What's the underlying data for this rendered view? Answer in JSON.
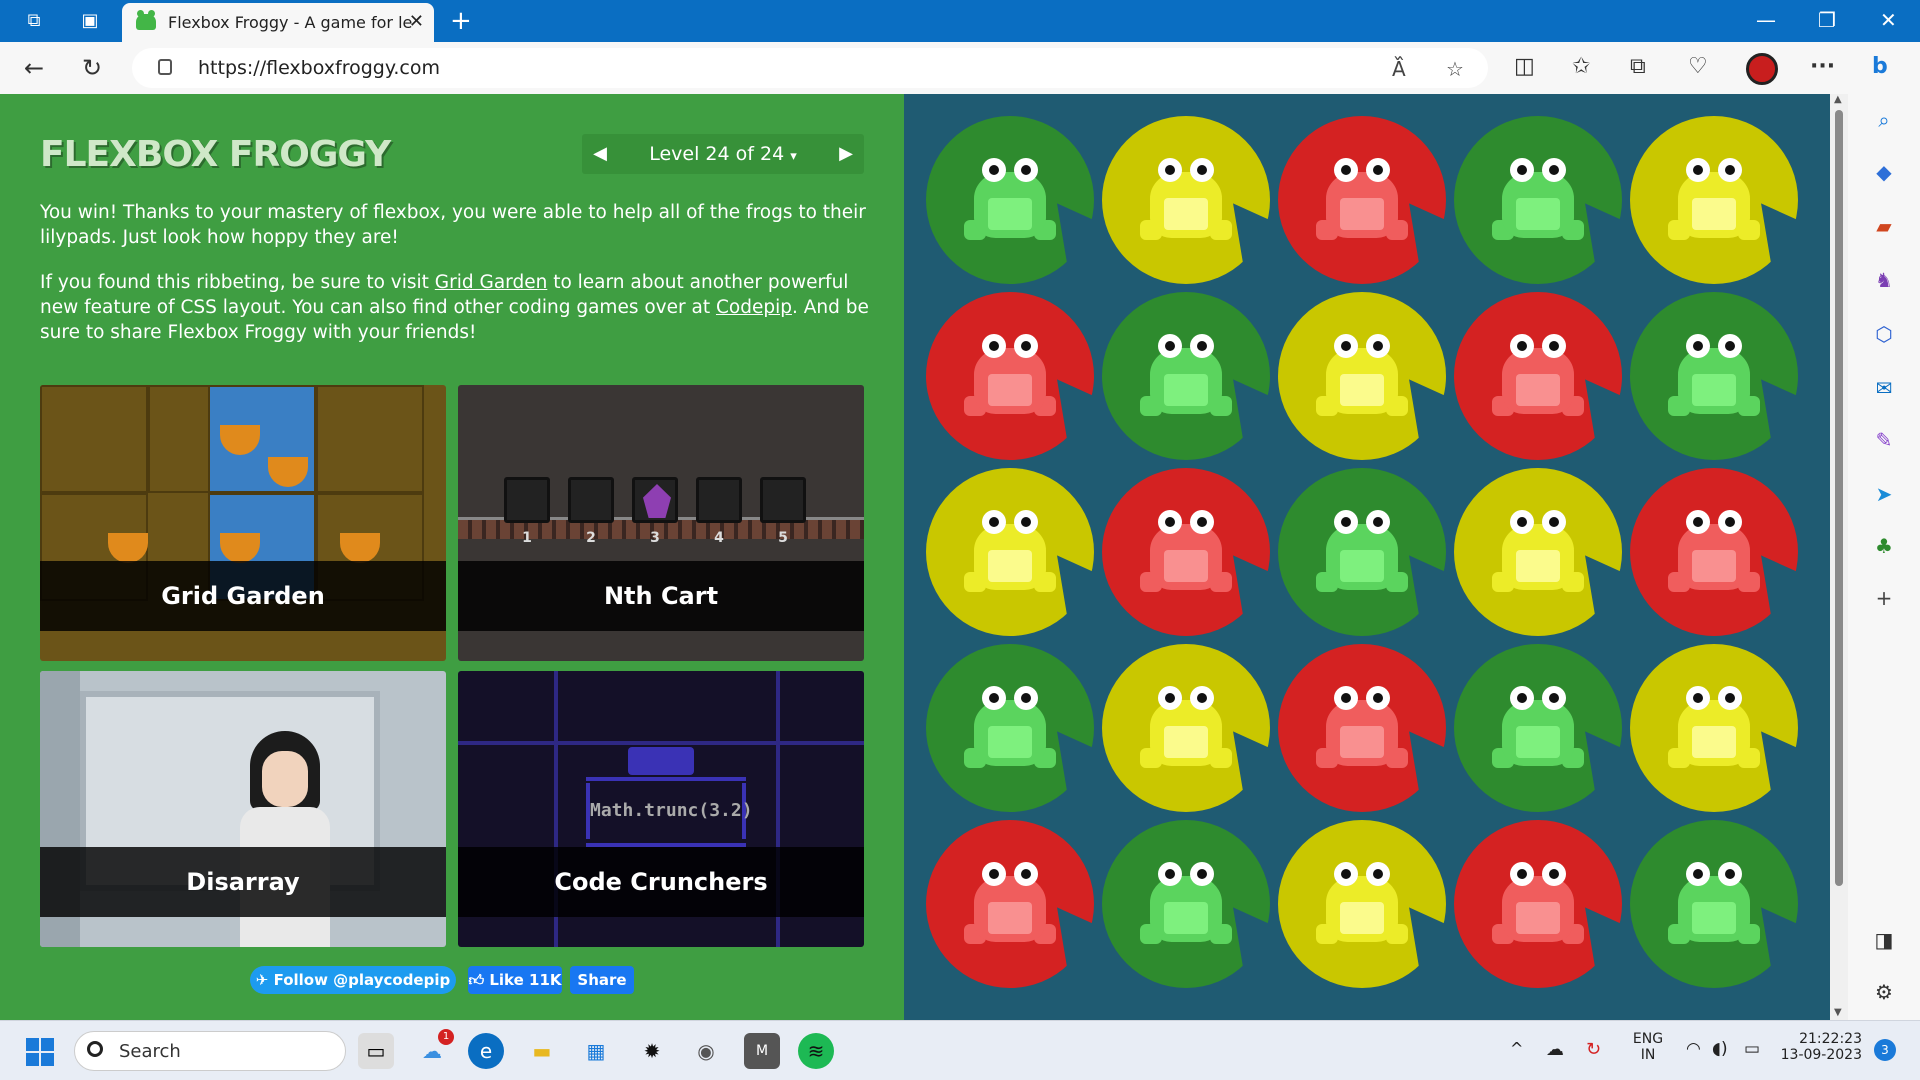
{
  "browser": {
    "tab_title": "Flexbox Froggy - A game for lear",
    "tab_close": "✕",
    "new_tab": "+",
    "url": "https://flexboxfroggy.com",
    "window_controls": {
      "minimize": "—",
      "restore": "❐",
      "close": "✕"
    },
    "menu_label": "···"
  },
  "game": {
    "logo": "FLEXBOX FROGGY",
    "level_label": "Level 24 of 24",
    "level_caret": "▾",
    "prev_arrow": "◀",
    "next_arrow": "▶",
    "win_text": "You win! Thanks to your mastery of flexbox, you were able to help all of the frogs to their lilypads. Just look how hoppy they are!",
    "visit": {
      "p1": "If you found this ribbeting, be sure to visit ",
      "link1": "Grid Garden",
      "p2": " to learn about another powerful new feature of CSS layout. You can also find other coding games over at ",
      "link2": "Codepip",
      "p3": ". And be sure to share Flexbox Froggy with your friends!"
    },
    "cards": [
      {
        "title": "Grid Garden"
      },
      {
        "title": "Nth Cart"
      },
      {
        "title": "Disarray"
      },
      {
        "title": "Code Crunchers"
      }
    ],
    "nth_cart_numbers": [
      "1",
      "2",
      "3",
      "4",
      "5"
    ],
    "code_crunchers_code": "Math.trunc(3.2)",
    "social": {
      "follow": "Follow @playcodepip",
      "like": "Like 11K",
      "share": "Share"
    }
  },
  "pond": {
    "colors": {
      "green": {
        "pad": "#2e8b2e",
        "frog": "#5bd45e",
        "belly": "#7ef07e"
      },
      "yellow": {
        "pad": "#c9c700",
        "frog": "#ecec28",
        "belly": "#fbfb8c"
      },
      "red": {
        "pad": "#d42222",
        "frog": "#f05d5d",
        "belly": "#f99090"
      }
    },
    "grid": [
      [
        "green",
        "yellow",
        "red",
        "green",
        "yellow"
      ],
      [
        "red",
        "green",
        "yellow",
        "red",
        "green"
      ],
      [
        "yellow",
        "red",
        "green",
        "yellow",
        "red"
      ],
      [
        "green",
        "yellow",
        "red",
        "green",
        "yellow"
      ],
      [
        "red",
        "green",
        "yellow",
        "red",
        "green"
      ]
    ]
  },
  "sidebar": {
    "icons": [
      "search-icon",
      "tag-icon",
      "briefcase-icon",
      "chess-icon",
      "copilot-icon",
      "outlook-icon",
      "designer-icon",
      "send-icon",
      "tree-icon",
      "add-icon",
      "split-icon",
      "settings-icon"
    ]
  },
  "taskbar": {
    "search_label": "Search",
    "weather_badge": "1",
    "lang_top": "ENG",
    "lang_bottom": "IN",
    "time": "21:22:23",
    "date": "13-09-2023",
    "notification_count": "3",
    "chevron": "^"
  }
}
